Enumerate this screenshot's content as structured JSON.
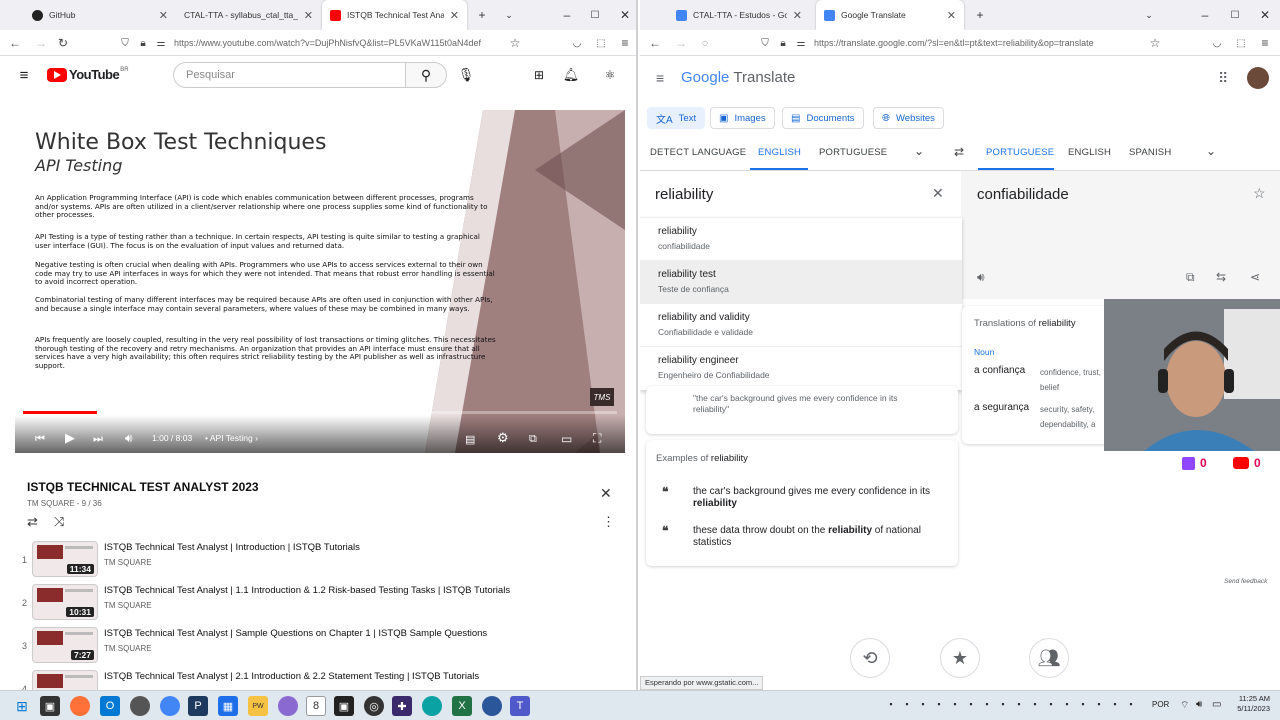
{
  "left_window": {
    "tabs": [
      {
        "title": "GitHub",
        "active": false
      },
      {
        "title": "CTAL-TTA - syllabus_ctal_tta_4.0br.p",
        "active": false
      },
      {
        "title": "ISTQB Technical Test Analyst | 2.",
        "active": true
      }
    ],
    "url": "https://www.youtube.com/watch?v=DujPhNisfvQ&list=PL5VKaW115t0aN4def",
    "youtube": {
      "logo": "YouTube",
      "logo_region": "BR",
      "search_placeholder": "Pesquisar",
      "slide": {
        "title": "White Box Test Techniques",
        "subtitle": "API Testing",
        "paragraphs": [
          "An Application Programming Interface (API) is code which enables communication between different processes, programs and/or systems. APIs are often utilized in a client/server relationship where one process supplies some kind of functionality to other processes.",
          "API Testing is a type of testing rather than a technique. In certain respects, API testing is quite similar to testing a graphical user interface (GUI). The focus is on the evaluation of input values and returned data.",
          "Negative testing is often crucial when dealing with APIs. Programmers who use APIs to access services external to their own code may try to use API interfaces in ways for which they were not intended. That means that robust error handling is essential to avoid incorrect operation.",
          "Combinatorial testing of many different interfaces may be required because APIs are often used in conjunction with other APIs, and because a single interface may contain several parameters, where values of these may be combined in many ways.",
          "APIs frequently are loosely coupled, resulting in the very real possibility of lost transactions or timing glitches. This necessitates thorough testing of the recovery and retry mechanisms. An organization that provides an API interface must ensure that all services have a very high availability; this often requires strict reliability testing by the API publisher as well as infrastructure support."
        ],
        "watermark": "TMS"
      },
      "player": {
        "time": "1:00 / 8:03",
        "chapter": "API Testing",
        "progress": 0.124
      },
      "playlist": {
        "title": "ISTQB TECHNICAL TEST ANALYST 2023",
        "meta": "TM SQUARE - 9 / 36",
        "items": [
          {
            "num": "1",
            "title": "ISTQB Technical Test Analyst | Introduction | ISTQB Tutorials",
            "channel": "TM SQUARE",
            "duration": "11:34"
          },
          {
            "num": "2",
            "title": "ISTQB Technical Test Analyst | 1.1 Introduction & 1.2 Risk-based Testing Tasks | ISTQB Tutorials",
            "channel": "TM SQUARE",
            "duration": "10:31"
          },
          {
            "num": "3",
            "title": "ISTQB Technical Test Analyst | Sample Questions on Chapter 1 | ISTQB Sample Questions",
            "channel": "TM SQUARE",
            "duration": "7:27"
          },
          {
            "num": "4",
            "title": "ISTQB Technical Test Analyst | 2.1 Introduction & 2.2 Statement Testing | ISTQB Tutorials",
            "channel": "TM SQUARE",
            "duration": ""
          }
        ]
      }
    }
  },
  "right_window": {
    "tabs": [
      {
        "title": "CTAL-TTA - Estudos - Google Do",
        "active": false
      },
      {
        "title": "Google Translate",
        "active": true
      }
    ],
    "url": "https://translate.google.com/?sl=en&tl=pt&text=reliability&op=translate",
    "translate": {
      "logo_google": "Google",
      "logo_product": "Translate",
      "modes": [
        "Text",
        "Images",
        "Documents",
        "Websites"
      ],
      "source_langs": [
        "DETECT LANGUAGE",
        "ENGLISH",
        "PORTUGUESE"
      ],
      "target_langs": [
        "PORTUGUESE",
        "ENGLISH",
        "SPANISH"
      ],
      "input_text": "reliability",
      "output_text": "confiabilidade",
      "suggestions": [
        {
          "term": "reliability",
          "translation": "confiabilidade"
        },
        {
          "term": "reliability test",
          "translation": "Teste de confiança"
        },
        {
          "term": "reliability and validity",
          "translation": "Confiabilidade e validade"
        },
        {
          "term": "reliability engineer",
          "translation": "Engenheiro de Confiabilidade"
        }
      ],
      "definition_quote": "\"the car's background gives me every confidence in its reliability\"",
      "translations_heading": "Translations of",
      "translations_word": "reliability",
      "pos": "Noun",
      "translations": [
        {
          "pt": "a confiança",
          "en": "confidence, trust, belief"
        },
        {
          "pt": "a segurança",
          "en": "security, safety, dependability, a"
        }
      ],
      "examples_heading": "Examples of",
      "examples_word": "reliability",
      "examples": [
        {
          "before": "the car's background gives me every confidence in its ",
          "bold": "reliability",
          "after": ""
        },
        {
          "before": "these data throw doubt on the ",
          "bold": "reliability",
          "after": " of national statistics"
        }
      ],
      "send_feedback": "Send feedback",
      "status": "Esperando por www.gstatic.com..."
    },
    "overlay": {
      "stream_counts": [
        {
          "platform": "twitch",
          "count": "0"
        },
        {
          "platform": "youtube",
          "count": "0"
        }
      ]
    }
  },
  "taskbar": {
    "lang": "POR",
    "time": "11:25 AM",
    "date": "5/11/2023"
  },
  "colors": {
    "youtube_red": "#ff0000",
    "google_blue": "#1a73e8",
    "twitch_purple": "#9146ff"
  }
}
